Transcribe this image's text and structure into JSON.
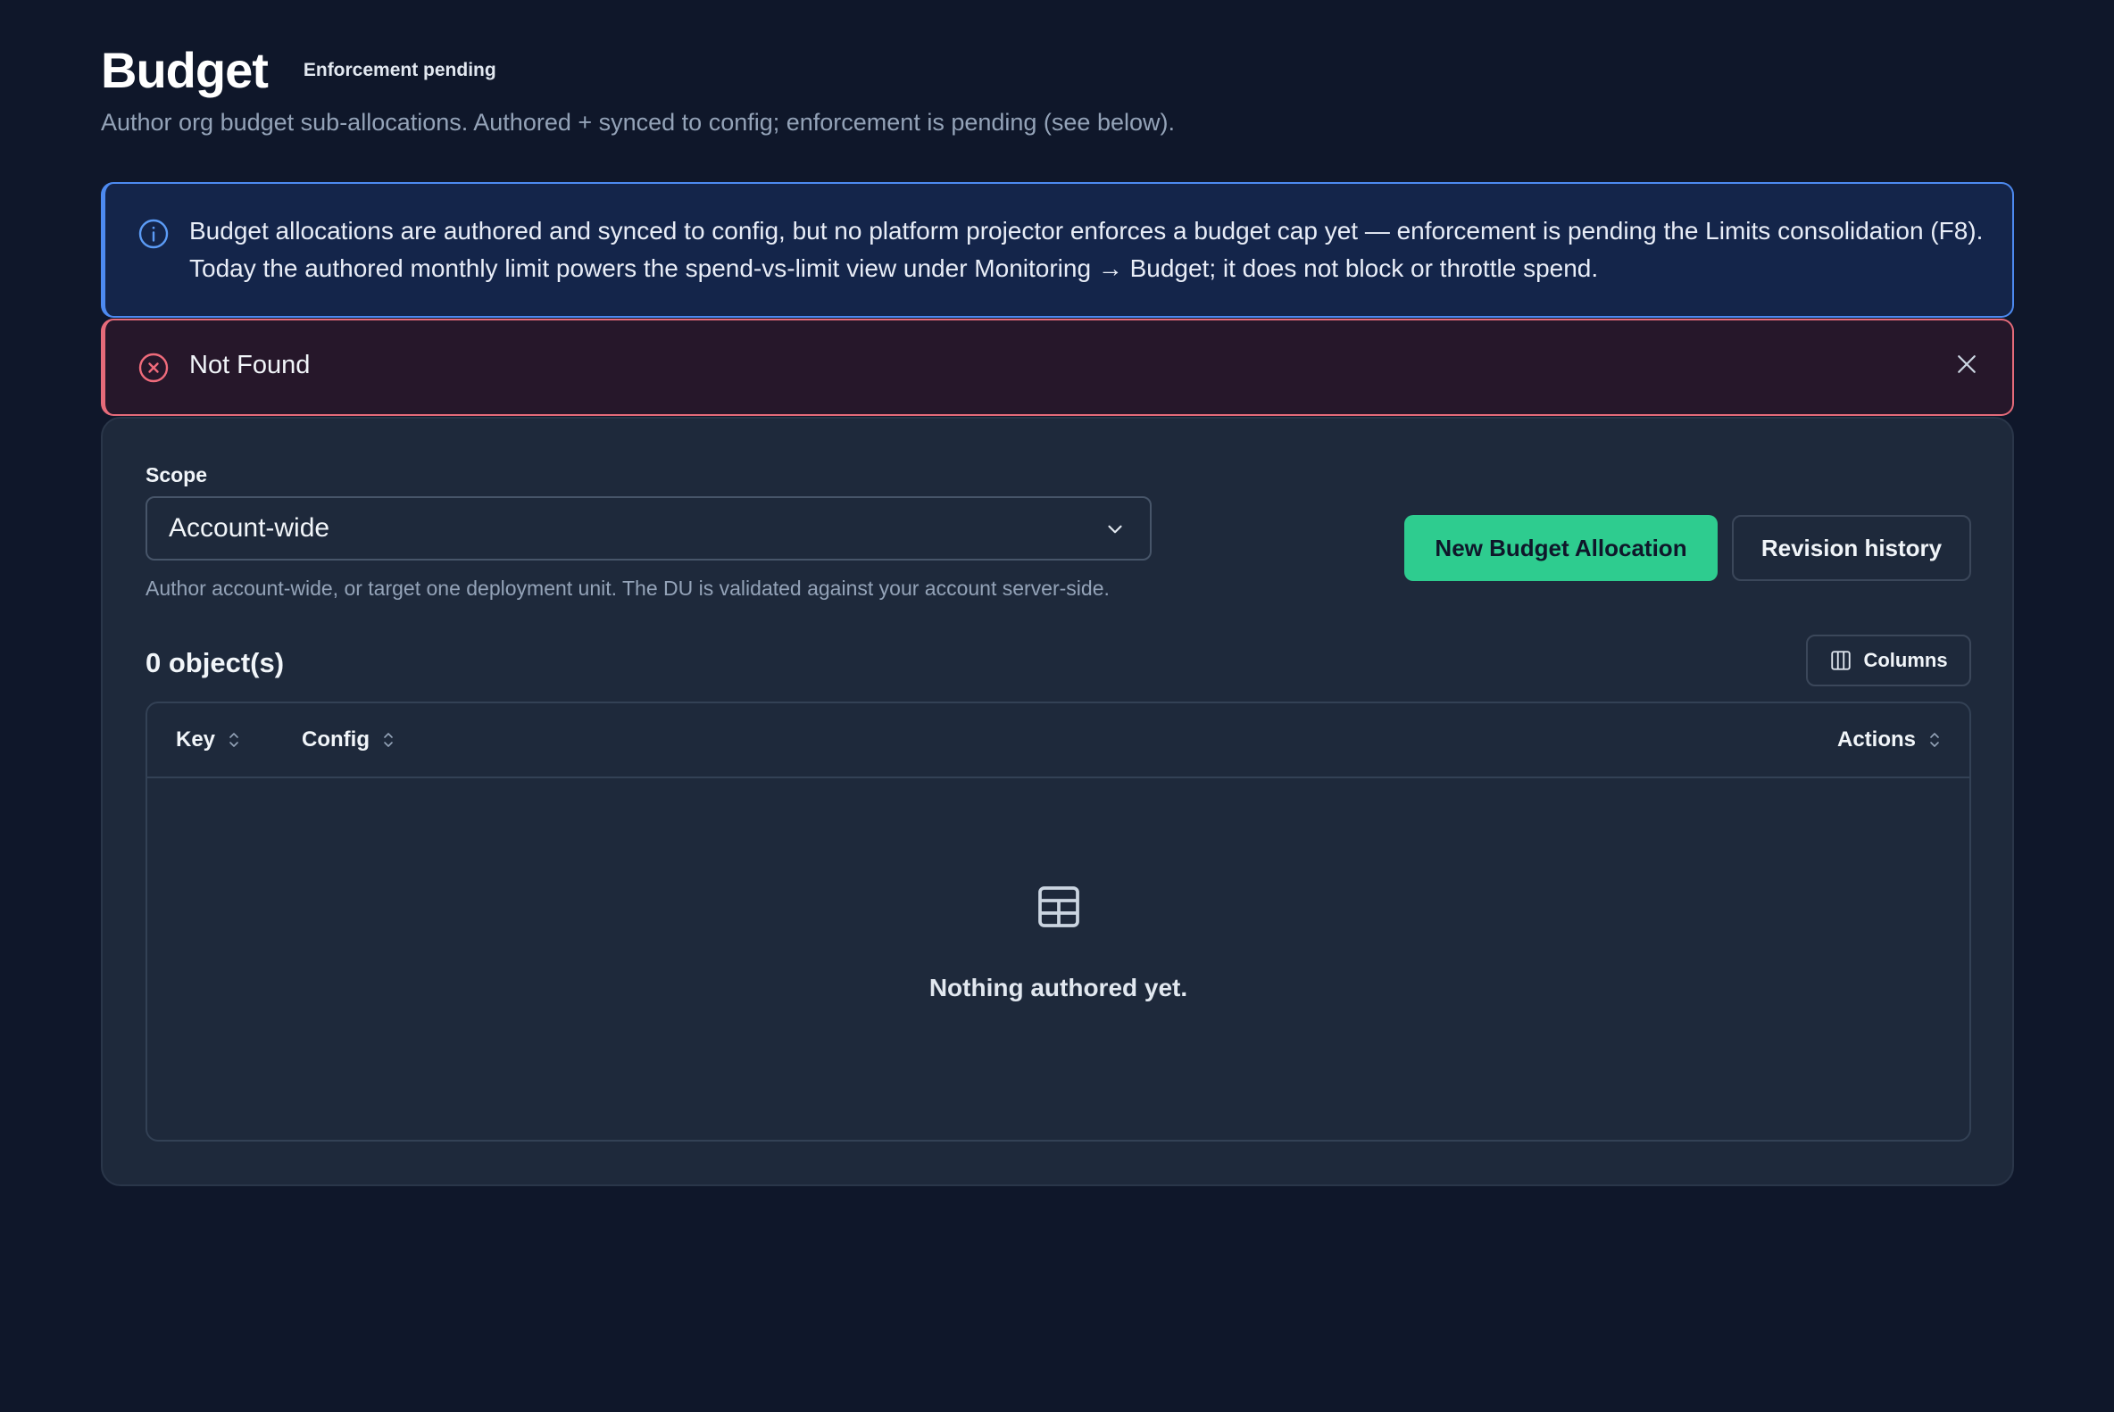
{
  "header": {
    "title": "Budget",
    "badge": "Enforcement pending",
    "subtitle": "Author org budget sub-allocations. Authored + synced to config; enforcement is pending (see below)."
  },
  "info_alert": {
    "icon": "info-circle-icon",
    "line1": "Budget allocations are authored and synced to config, but no platform projector enforces a budget cap yet — enforcement is pending the Limits consolidation (F8).",
    "line2": "Today the authored monthly limit powers the spend-vs-limit view under Monitoring → Budget; it does not block or throttle spend."
  },
  "error_alert": {
    "icon": "x-circle-icon",
    "text": "Not Found"
  },
  "scope": {
    "label": "Scope",
    "value": "Account-wide",
    "help": "Author account-wide, or target one deployment unit. The DU is validated against your account server-side."
  },
  "actions": {
    "new_label": "New Budget Allocation",
    "history_label": "Revision history",
    "columns_label": "Columns"
  },
  "table": {
    "count": "0 object(s)",
    "columns": [
      "Key",
      "Config",
      "Actions"
    ],
    "empty_text": "Nothing authored yet."
  },
  "colors": {
    "background": "#0f172a",
    "card": "#1e293b",
    "primary": "#2ecc8f",
    "info": "#4d8af0",
    "error": "#e56b7a"
  }
}
